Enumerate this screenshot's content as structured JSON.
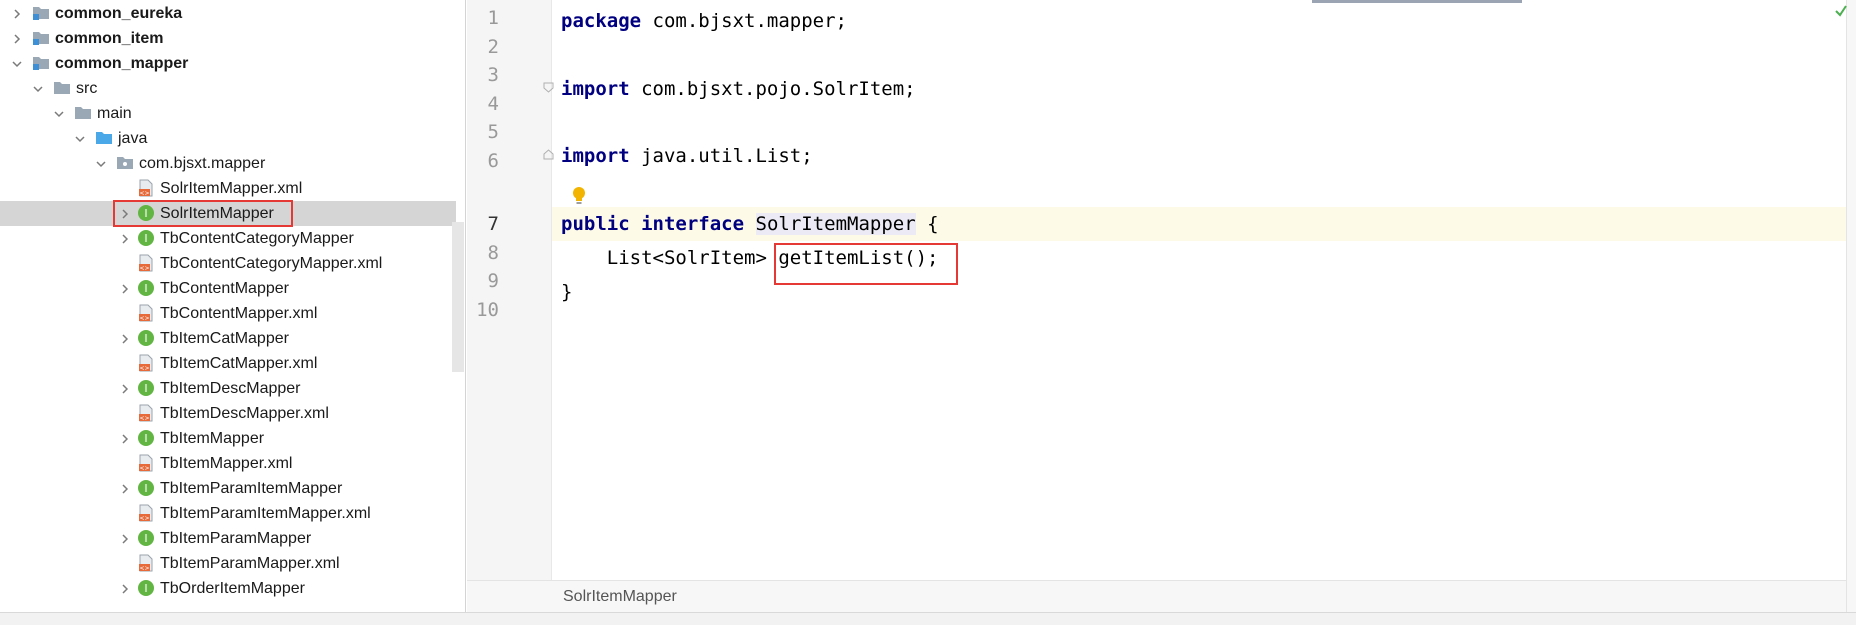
{
  "project_tree": {
    "nodes": [
      {
        "label": "common_eureka",
        "bold": true,
        "icon": "module-folder-icon",
        "chevron": "right"
      },
      {
        "label": "common_item",
        "bold": true,
        "icon": "module-folder-icon",
        "chevron": "right"
      },
      {
        "label": "common_mapper",
        "bold": true,
        "icon": "module-folder-icon",
        "chevron": "down"
      },
      {
        "label": "src",
        "icon": "folder-icon",
        "chevron": "down"
      },
      {
        "label": "main",
        "icon": "folder-icon",
        "chevron": "down"
      },
      {
        "label": "java",
        "icon": "source-folder-icon",
        "chevron": "down"
      },
      {
        "label": "com.bjsxt.mapper",
        "icon": "package-icon",
        "chevron": "down"
      },
      {
        "label": "SolrItemMapper.xml",
        "icon": "xml-file-icon",
        "chevron": "none"
      },
      {
        "label": "SolrItemMapper",
        "icon": "interface-icon",
        "chevron": "right",
        "selected": true
      },
      {
        "label": "TbContentCategoryMapper",
        "icon": "interface-icon",
        "chevron": "right"
      },
      {
        "label": "TbContentCategoryMapper.xml",
        "icon": "xml-file-icon",
        "chevron": "none"
      },
      {
        "label": "TbContentMapper",
        "icon": "interface-icon",
        "chevron": "right"
      },
      {
        "label": "TbContentMapper.xml",
        "icon": "xml-file-icon",
        "chevron": "none"
      },
      {
        "label": "TbItemCatMapper",
        "icon": "interface-icon",
        "chevron": "right"
      },
      {
        "label": "TbItemCatMapper.xml",
        "icon": "xml-file-icon",
        "chevron": "none"
      },
      {
        "label": "TbItemDescMapper",
        "icon": "interface-icon",
        "chevron": "right"
      },
      {
        "label": "TbItemDescMapper.xml",
        "icon": "xml-file-icon",
        "chevron": "none"
      },
      {
        "label": "TbItemMapper",
        "icon": "interface-icon",
        "chevron": "right"
      },
      {
        "label": "TbItemMapper.xml",
        "icon": "xml-file-icon",
        "chevron": "none"
      },
      {
        "label": "TbItemParamItemMapper",
        "icon": "interface-icon",
        "chevron": "right"
      },
      {
        "label": "TbItemParamItemMapper.xml",
        "icon": "xml-file-icon",
        "chevron": "none"
      },
      {
        "label": "TbItemParamMapper",
        "icon": "interface-icon",
        "chevron": "right"
      },
      {
        "label": "TbItemParamMapper.xml",
        "icon": "xml-file-icon",
        "chevron": "none"
      },
      {
        "label": "TbOrderItemMapper",
        "icon": "interface-icon",
        "chevron": "right"
      }
    ]
  },
  "editor": {
    "line_numbers": [
      "1",
      "2",
      "3",
      "4",
      "5",
      "6",
      "7",
      "8",
      "9",
      "10"
    ],
    "lines": {
      "l1_kw": "package",
      "l1_rest": " com.bjsxt.mapper;",
      "l3_kw": "import",
      "l3_rest": " com.bjsxt.pojo.SolrItem;",
      "l5_kw": "import",
      "l5_rest": " java.util.List;",
      "l7_kw1": "public",
      "l7_kw2": "interface",
      "l7_ident": "SolrItemMapper",
      "l7_rest": " {",
      "l8_pre": "    List<SolrItem> ",
      "l8_method": "getItemList();",
      "l9": "}"
    },
    "breadcrumb": "SolrItemMapper",
    "intention_icon": "lightbulb-icon",
    "status_icon": "check-icon"
  },
  "colors": {
    "keyword": "#000080",
    "highlight_box": "#e53935",
    "current_line": "#fdfbe7",
    "interface_icon": "#62b543"
  }
}
